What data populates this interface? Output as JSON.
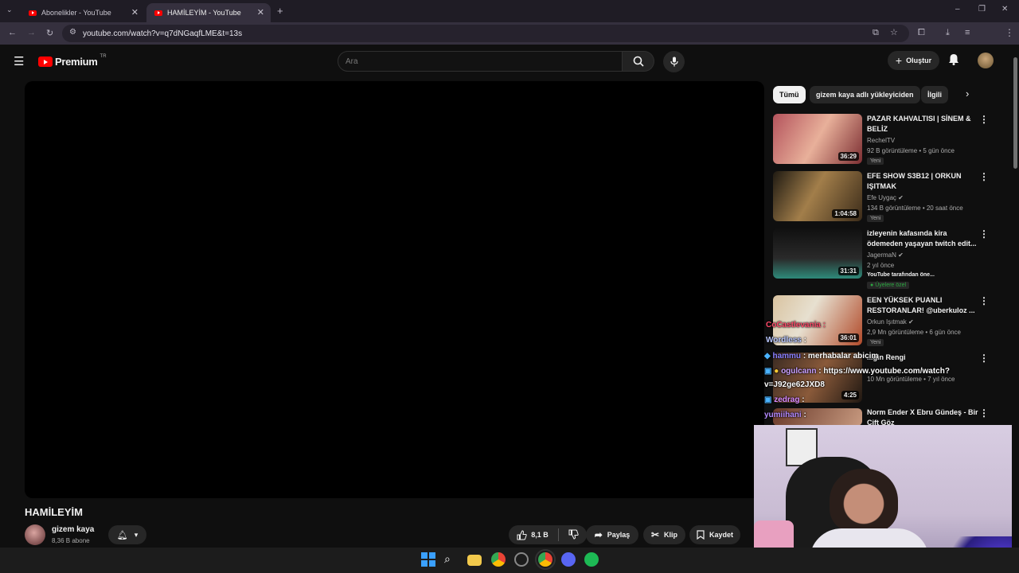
{
  "browser": {
    "tabs": [
      {
        "title": "Abonelikler - YouTube",
        "active": false
      },
      {
        "title": "HAMİLEYİM - YouTube",
        "active": true
      }
    ],
    "url": "youtube.com/watch?v=q7dNGaqfLME&t=13s"
  },
  "header": {
    "logo_text": "Premium",
    "region": "TR",
    "search_placeholder": "Ara",
    "create_label": "Oluştur"
  },
  "video": {
    "title": "HAMİLEYİM",
    "channel": "gizem kaya",
    "subscribers": "8,36 B abone",
    "likes": "8,1 B",
    "share_label": "Paylaş",
    "clip_label": "Klip",
    "save_label": "Kaydet"
  },
  "chips": [
    "Tümü",
    "gizem kaya adlı yükleyiciden",
    "İlgili"
  ],
  "recommendations": [
    {
      "title": "PAZAR KAHVALTISI | SİNEM & BELİZ",
      "channel": "RechelTV",
      "meta": "92 B görüntüleme • 5 gün önce",
      "badge": "Yeni",
      "duration": "36:29"
    },
    {
      "title": "EFE SHOW S3B12 | ORKUN IŞITMAK",
      "channel": "Efe Uygaç",
      "meta": "134 B görüntüleme • 20 saat önce",
      "badge": "Yeni",
      "duration": "1:04:58"
    },
    {
      "title": "izleyenin kafasında kira ödemeden yaşayan twitch edit...",
      "channel": "JagermaN",
      "meta": "2 yıl önce",
      "extra": "YouTube tarafından öne...",
      "members": "Üyelere özel",
      "duration": "31:31"
    },
    {
      "title": "EEN YÜKSEK PUANLI RESTORANLAR! @uberkuloz ...",
      "channel": "Orkun Işıtmak",
      "meta": "2,9 Mn görüntüleme • 6 gün önce",
      "badge": "Yeni",
      "duration": "36:01"
    },
    {
      "title": "...gin Rengi",
      "channel": "",
      "meta": "10 Mn görüntüleme • 7 yıl önce",
      "duration": "4:25"
    },
    {
      "title": "Norm Ender X Ebru Gündeş - Bir Çift Göz",
      "channel": "",
      "meta": ""
    }
  ],
  "chat_overlay": [
    {
      "user": "CoCastlevania",
      "message": ":"
    },
    {
      "user": "Wordless",
      "message": ":"
    },
    {
      "user": "hammu",
      "message": ": merhabalar abicim"
    },
    {
      "user": "ogulcann",
      "message": ": https://www.youtube.com/watch?"
    },
    {
      "user": "",
      "message": "v=J92ge62JXD8"
    },
    {
      "user": "zedrag",
      "message": ":"
    },
    {
      "user": "yumiihani",
      "message": ":"
    }
  ],
  "colors": {
    "youtube_red": "#ff0000",
    "background": "#0f0f0f",
    "chip_bg": "#272727",
    "members_green": "#2ba640"
  }
}
